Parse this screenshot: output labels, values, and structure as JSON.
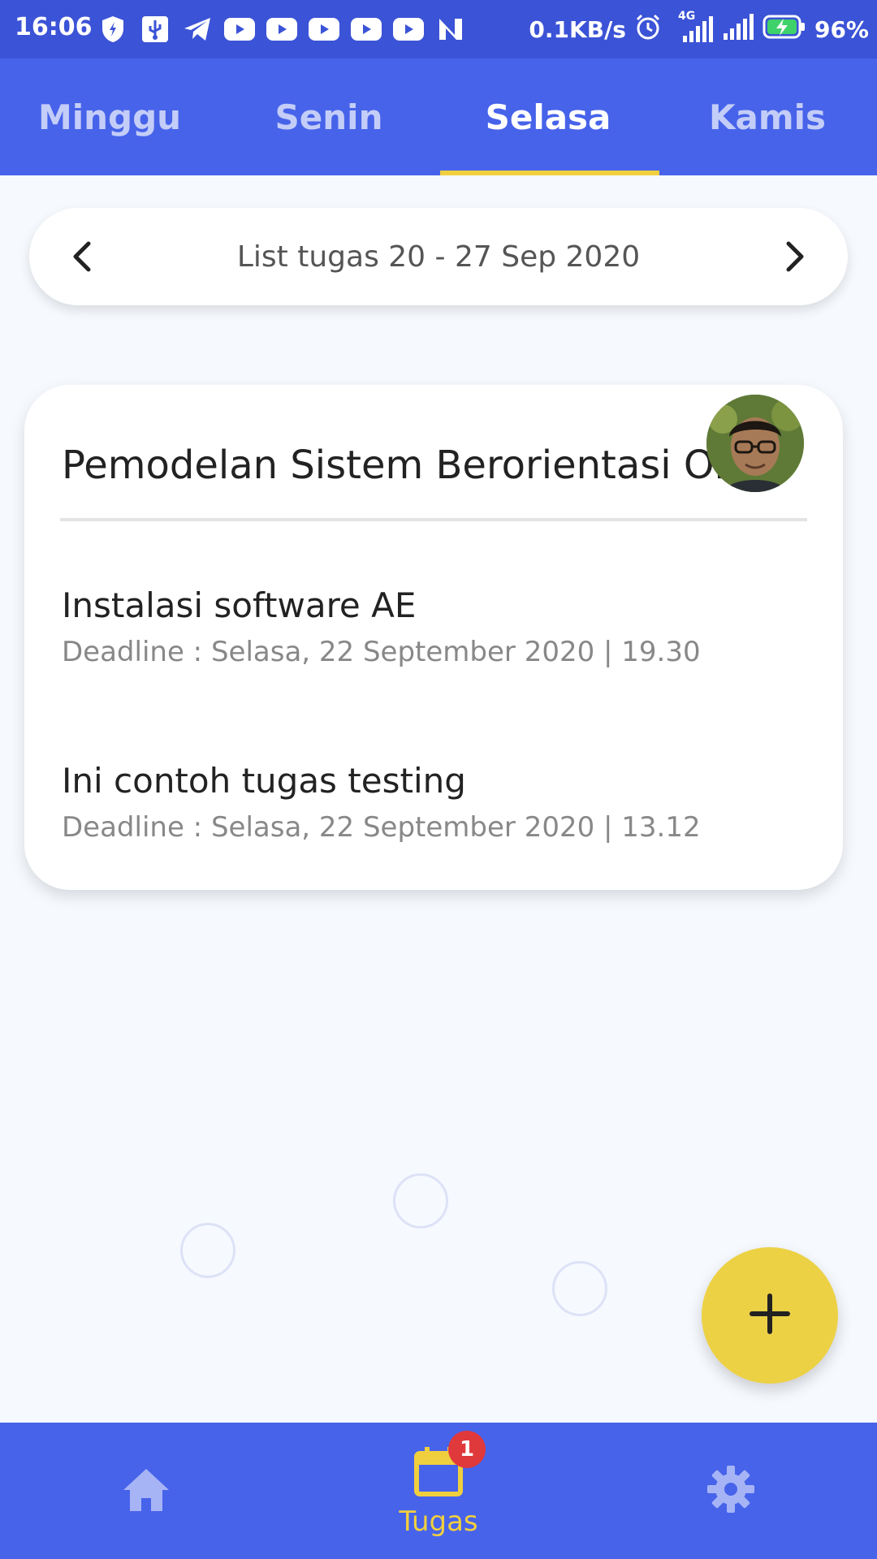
{
  "status_bar": {
    "time": "16:06",
    "network_speed": "0.1KB/s",
    "network_type": "4G",
    "battery": "96%",
    "icons": [
      "shield-icon",
      "usb-icon",
      "telegram-icon",
      "youtube-icon",
      "youtube-icon",
      "youtube-icon",
      "youtube-icon",
      "youtube-icon",
      "n-icon",
      "alarm-icon",
      "signal-icon",
      "signal-icon",
      "battery-charging-icon"
    ]
  },
  "tabs": [
    {
      "label": "Minggu"
    },
    {
      "label": "Senin"
    },
    {
      "label": "Selasa",
      "active": true
    },
    {
      "label": "Kamis"
    }
  ],
  "week_nav": {
    "label": "List tugas 20 - 27 Sep 2020",
    "prev_icon": "chevron-left-icon",
    "next_icon": "chevron-right-icon"
  },
  "course_card": {
    "title": "Pemodelan Sistem Berorientasi Objek",
    "tasks": [
      {
        "title": "Instalasi software AE",
        "deadline": "Deadline : Selasa, 22 September 2020 | 19.30"
      },
      {
        "title": "Ini contoh tugas testing",
        "deadline": "Deadline : Selasa, 22 September 2020 | 13.12"
      }
    ]
  },
  "fab": {
    "icon": "plus-icon"
  },
  "bottom_nav": {
    "home_icon": "home-icon",
    "tasks_icon": "calendar-icon",
    "tasks_label": "Tugas",
    "tasks_badge": "1",
    "settings_icon": "gear-icon"
  },
  "colors": {
    "primary": "#4763ea",
    "status_bar": "#3b53d6",
    "accent": "#f0cf3e",
    "fab": "#ecd144",
    "badge": "#e0393c",
    "background": "#f6f9fe"
  }
}
